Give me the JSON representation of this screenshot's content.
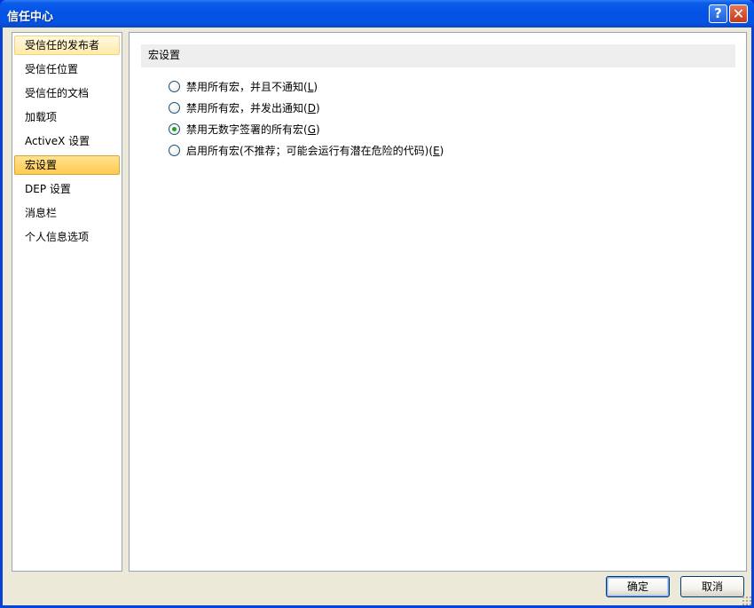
{
  "window": {
    "title": "信任中心"
  },
  "titlebar": {
    "help_symbol": "?",
    "close_symbol": "✕"
  },
  "nav": {
    "items": [
      {
        "label": "受信任的发布者",
        "state": "hover"
      },
      {
        "label": "受信任位置",
        "state": "normal"
      },
      {
        "label": "受信任的文档",
        "state": "normal"
      },
      {
        "label": "加载项",
        "state": "normal"
      },
      {
        "label": "ActiveX 设置",
        "state": "normal"
      },
      {
        "label": "宏设置",
        "state": "selected"
      },
      {
        "label": "DEP 设置",
        "state": "normal"
      },
      {
        "label": "消息栏",
        "state": "normal"
      },
      {
        "label": "个人信息选项",
        "state": "normal"
      }
    ]
  },
  "content": {
    "header": "宏设置",
    "options": [
      {
        "text": "禁用所有宏，并且不通知(",
        "key": "L",
        "tail": ")",
        "checked": false
      },
      {
        "text": "禁用所有宏，并发出通知(",
        "key": "D",
        "tail": ")",
        "checked": false
      },
      {
        "text": "禁用无数字签署的所有宏(",
        "key": "G",
        "tail": ")",
        "checked": true
      },
      {
        "text": "启用所有宏(不推荐；可能会运行有潜在危险的代码)(",
        "key": "E",
        "tail": ")",
        "checked": false
      }
    ]
  },
  "buttons": {
    "ok": "确定",
    "cancel": "取消"
  },
  "colors": {
    "titlebar": "#0453e5",
    "selected_nav": "#ffcb4f",
    "radio_dot": "#21a121"
  }
}
